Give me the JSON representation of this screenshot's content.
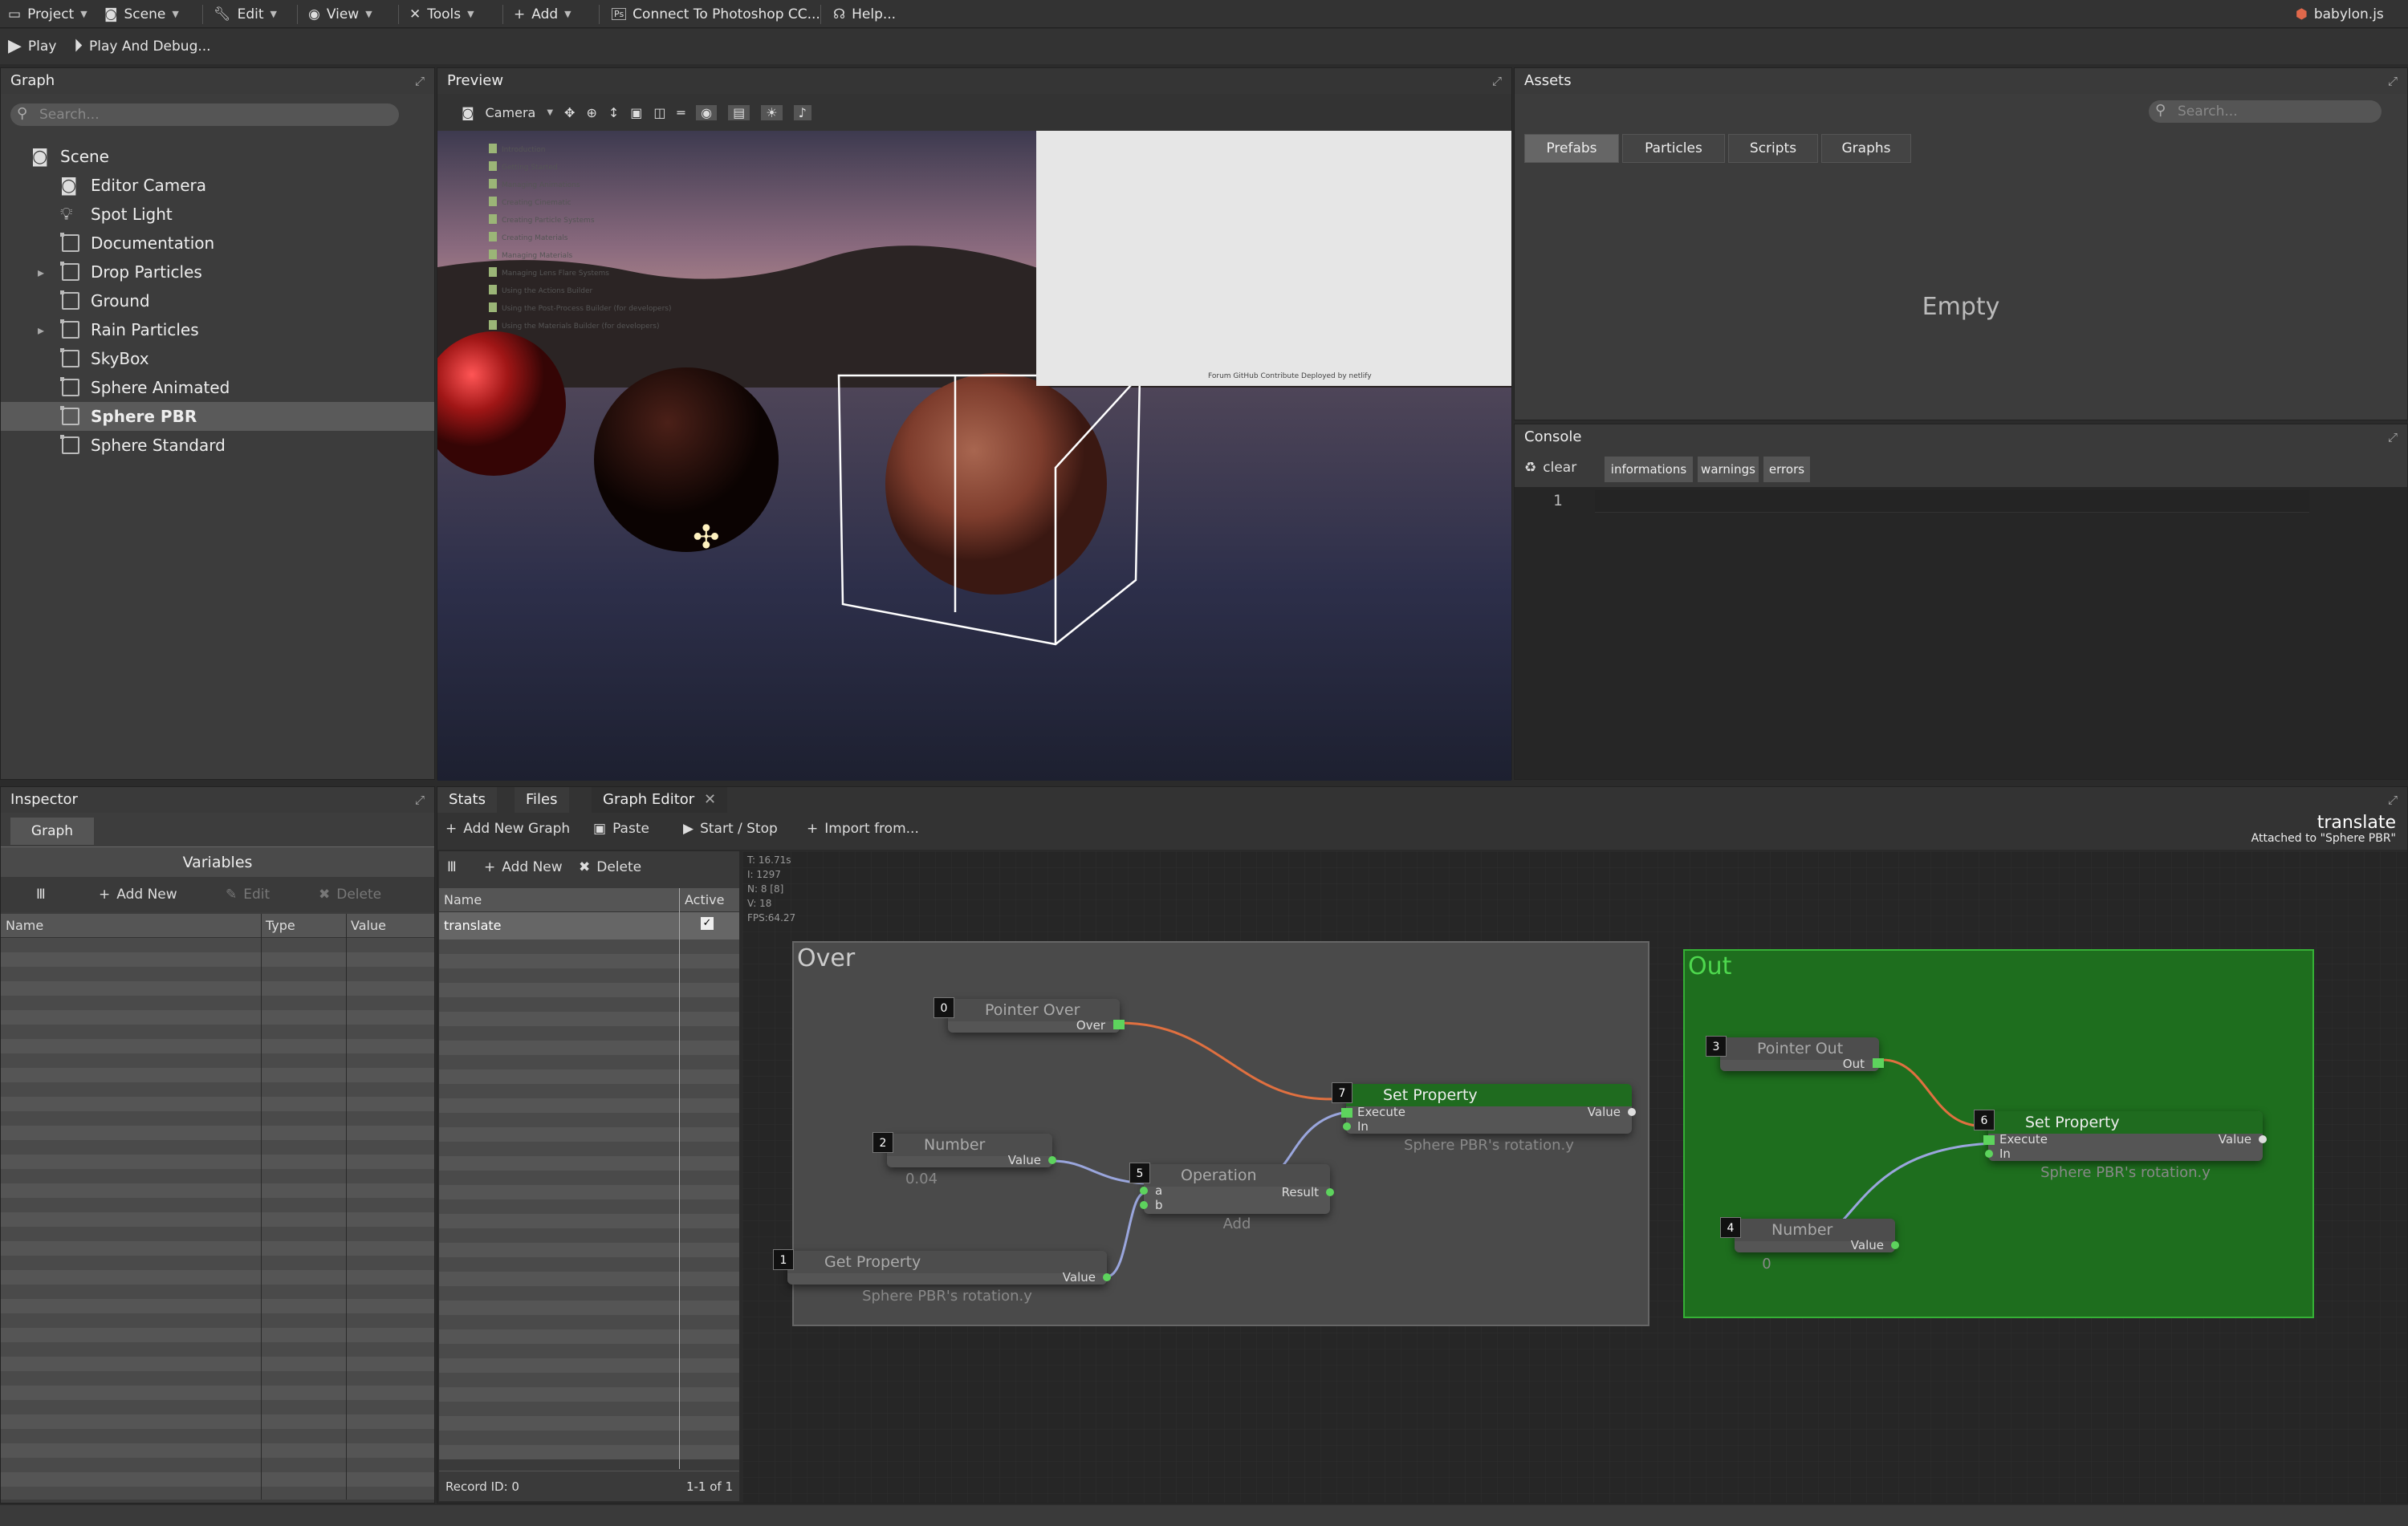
{
  "menu": {
    "items": [
      {
        "label": "Project",
        "icon": "folder-icon"
      },
      {
        "label": "Scene",
        "icon": "camera-icon"
      },
      {
        "label": "Edit",
        "icon": "wrench-icon"
      },
      {
        "label": "View",
        "icon": "eye-icon"
      },
      {
        "label": "Tools",
        "icon": "tools-icon"
      },
      {
        "label": "Add",
        "icon": "plus-icon"
      },
      {
        "label": "Connect To Photoshop CC...",
        "icon": "photoshop-icon"
      },
      {
        "label": "Help...",
        "icon": "help-icon"
      }
    ],
    "brand": "babylon.js",
    "play": "Play",
    "play_debug": "Play And Debug..."
  },
  "graph_panel": {
    "title": "Graph",
    "search_placeholder": "Search...",
    "root": "Scene",
    "items": [
      {
        "label": "Editor Camera",
        "icon": "camera-icon",
        "expand": false
      },
      {
        "label": "Spot Light",
        "icon": "light-icon",
        "expand": false
      },
      {
        "label": "Documentation",
        "icon": "mesh-icon",
        "expand": false
      },
      {
        "label": "Drop Particles",
        "icon": "mesh-icon",
        "expand": true
      },
      {
        "label": "Ground",
        "icon": "mesh-icon",
        "expand": false
      },
      {
        "label": "Rain Particles",
        "icon": "mesh-icon",
        "expand": true
      },
      {
        "label": "SkyBox",
        "icon": "mesh-icon",
        "expand": false
      },
      {
        "label": "Sphere Animated",
        "icon": "mesh-icon",
        "expand": false
      },
      {
        "label": "Sphere PBR",
        "icon": "mesh-icon",
        "expand": false,
        "selected": true
      },
      {
        "label": "Sphere Standard",
        "icon": "mesh-icon",
        "expand": false
      }
    ]
  },
  "preview": {
    "title": "Preview",
    "camera_label": "Camera",
    "doc_lines": [
      "Introduction",
      "Getting Started",
      "Managing Animations",
      "Creating Cinematic",
      "Creating Particle Systems",
      "Creating Materials",
      "Managing Materials",
      "Managing Lens Flare Systems",
      "Using the Actions Builder",
      "Using the Post-Process Builder (for developers)",
      "Using the Materials Builder (for developers)"
    ],
    "doc_footer": "Forum   GitHub   Contribute   Deployed by netlify"
  },
  "assets": {
    "title": "Assets",
    "search_placeholder": "Search...",
    "tabs": [
      "Prefabs",
      "Particles",
      "Scripts",
      "Graphs"
    ],
    "empty": "Empty"
  },
  "console": {
    "title": "Console",
    "clear": "clear",
    "filters": [
      "informations",
      "warnings",
      "errors"
    ],
    "line_number": "1"
  },
  "inspector": {
    "title": "Inspector",
    "tab": "Graph",
    "section": "Variables",
    "add_new": "Add New",
    "edit": "Edit",
    "delete": "Delete",
    "columns": [
      "Name",
      "Type",
      "Value"
    ]
  },
  "bottom_tabs": {
    "stats": "Stats",
    "files": "Files",
    "graph_editor": "Graph Editor"
  },
  "graph_editor": {
    "add_new_graph": "Add New Graph",
    "paste": "Paste",
    "start_stop": "Start / Stop",
    "import_from": "Import from...",
    "graph_name": "translate",
    "attached": "Attached to \"Sphere PBR\"",
    "list_add_new": "Add New",
    "list_delete": "Delete",
    "list_columns": [
      "Name",
      "Active"
    ],
    "list_rows": [
      {
        "name": "translate",
        "active": true
      }
    ],
    "record_id": "Record ID: 0",
    "record_count": "1-1 of 1",
    "stats": [
      "T: 16.71s",
      "I: 1297",
      "N: 8 [8]",
      "V: 18",
      "FPS:64.27"
    ],
    "groups": {
      "over": "Over",
      "out": "Out"
    },
    "nodes": {
      "pointer_over": {
        "id": "0",
        "title": "Pointer Over",
        "out": "Over"
      },
      "number2": {
        "id": "2",
        "title": "Number",
        "out": "Value",
        "sub": "0.04"
      },
      "get_property": {
        "id": "1",
        "title": "Get Property",
        "out": "Value",
        "sub": "Sphere PBR's rotation.y"
      },
      "operation": {
        "id": "5",
        "title": "Operation",
        "in_a": "a",
        "in_b": "b",
        "out": "Result",
        "sub": "Add"
      },
      "set_property7": {
        "id": "7",
        "title": "Set Property",
        "in_exec": "Execute",
        "in_in": "In",
        "out": "Value",
        "sub": "Sphere PBR's rotation.y"
      },
      "pointer_out": {
        "id": "3",
        "title": "Pointer Out",
        "out": "Out"
      },
      "number4": {
        "id": "4",
        "title": "Number",
        "out": "Value",
        "sub": "0"
      },
      "set_property6": {
        "id": "6",
        "title": "Set Property",
        "in_exec": "Execute",
        "in_in": "In",
        "out": "Value",
        "sub": "Sphere PBR's rotation.y"
      }
    }
  }
}
